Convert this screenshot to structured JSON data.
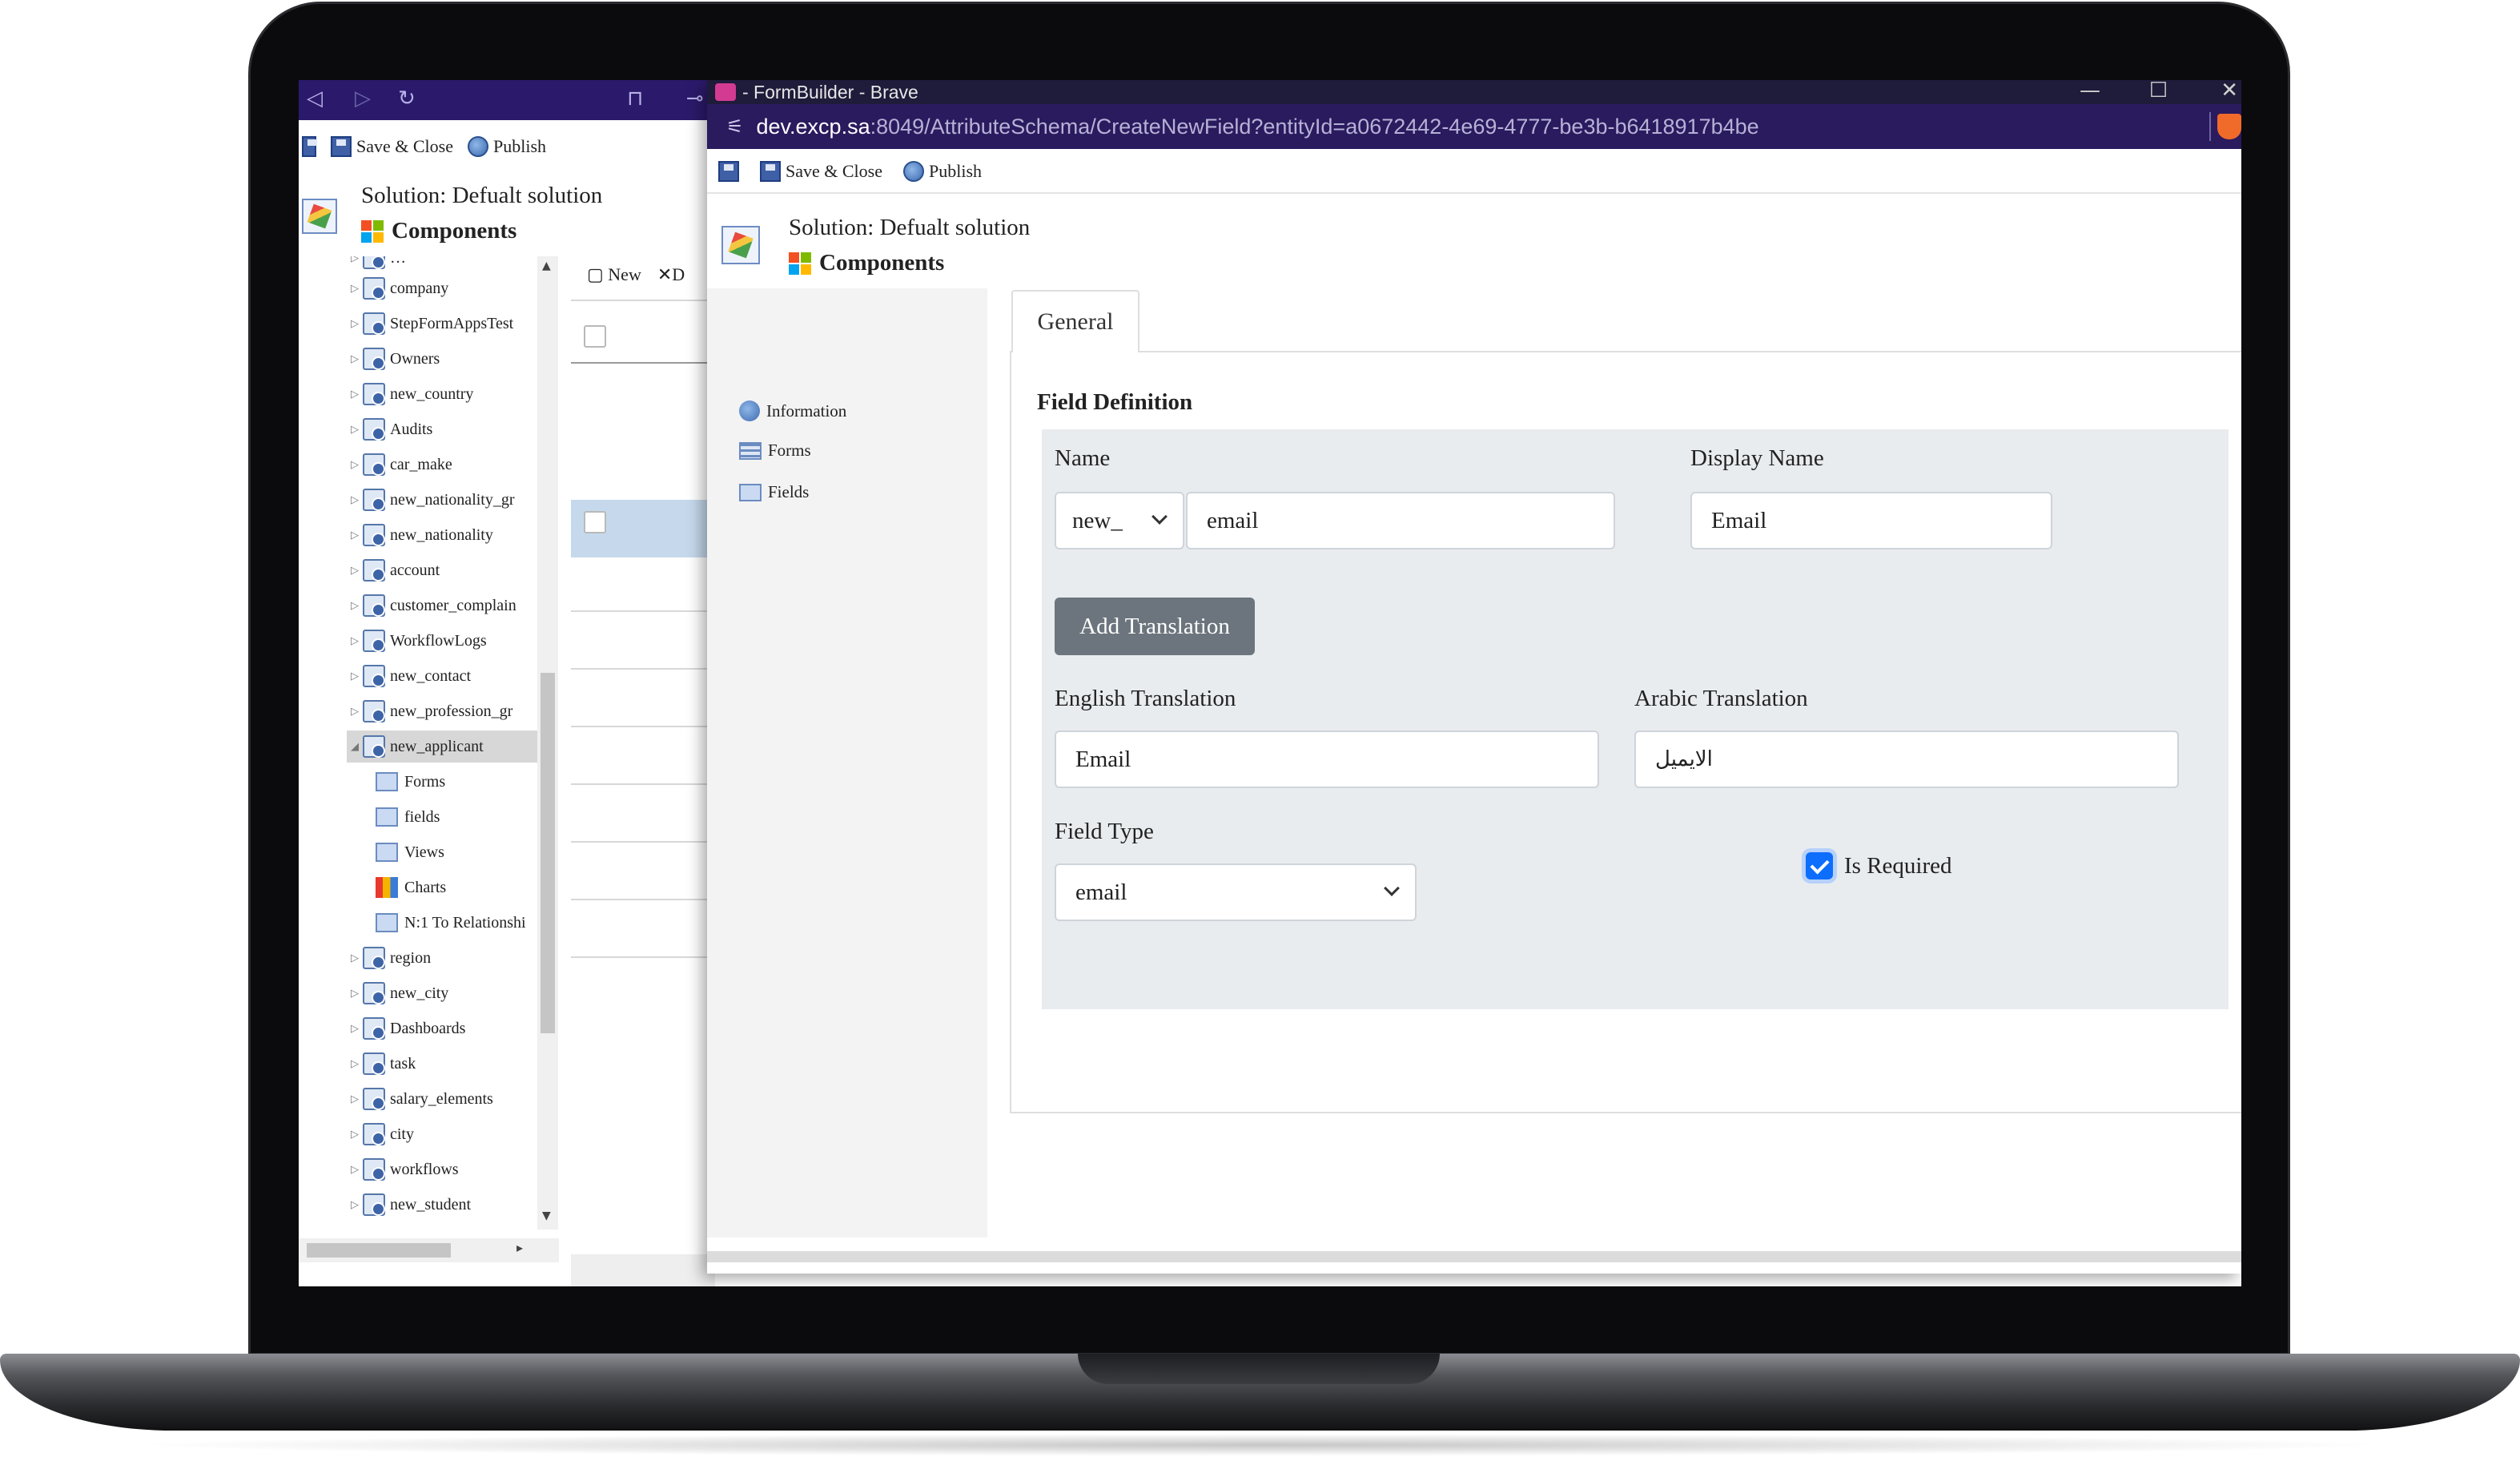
{
  "background_window": {
    "toolbar": {
      "save_close": "Save & Close",
      "publish": "Publish"
    },
    "solution_label": "Solution: Defualt solution",
    "components_label": "Components",
    "grid_toolbar": {
      "new": "New",
      "delete_partial": "D"
    },
    "tree_items": [
      "company",
      "StepFormAppsTest",
      "Owners",
      "new_country",
      "Audits",
      "car_make",
      "new_nationality_gr",
      "new_nationality",
      "account",
      "customer_complain",
      "WorkflowLogs",
      "new_contact",
      "new_profession_gr",
      "new_applicant"
    ],
    "selected_children": [
      "Forms",
      "fields",
      "Views",
      "Charts",
      "N:1 To Relationshi"
    ],
    "tree_items_after": [
      "region",
      "new_city",
      "Dashboards",
      "task",
      "salary_elements",
      "city",
      "workflows",
      "new_student"
    ]
  },
  "popup": {
    "window_title": "- FormBuilder - Brave",
    "url_host": "dev.excp.sa",
    "url_path": ":8049/AttributeSchema/CreateNewField?entityId=a0672442-4e69-4777-be3b-b6418917b4be",
    "toolbar": {
      "save_close": "Save & Close",
      "publish": "Publish"
    },
    "solution_label": "Solution: Defualt solution",
    "components_label": "Components",
    "nav": {
      "information": "Information",
      "forms": "Forms",
      "fields": "Fields"
    },
    "tab_general": "General",
    "form": {
      "section_title": "Field Definition",
      "name_label": "Name",
      "prefix_value": "new_",
      "name_value": "email",
      "display_name_label": "Display Name",
      "display_name_value": "Email",
      "add_translation_button": "Add Translation",
      "english_translation_label": "English Translation",
      "english_translation_value": "Email",
      "arabic_translation_label": "Arabic Translation",
      "arabic_translation_value": "الايميل",
      "field_type_label": "Field Type",
      "field_type_value": "email",
      "is_required_label": "Is Required",
      "is_required_checked": true
    }
  },
  "colors": {
    "accent": "#0d6efd",
    "button_secondary": "#6c757d",
    "form_background": "#e9ecef",
    "browser_bar": "#2a1a5e"
  }
}
